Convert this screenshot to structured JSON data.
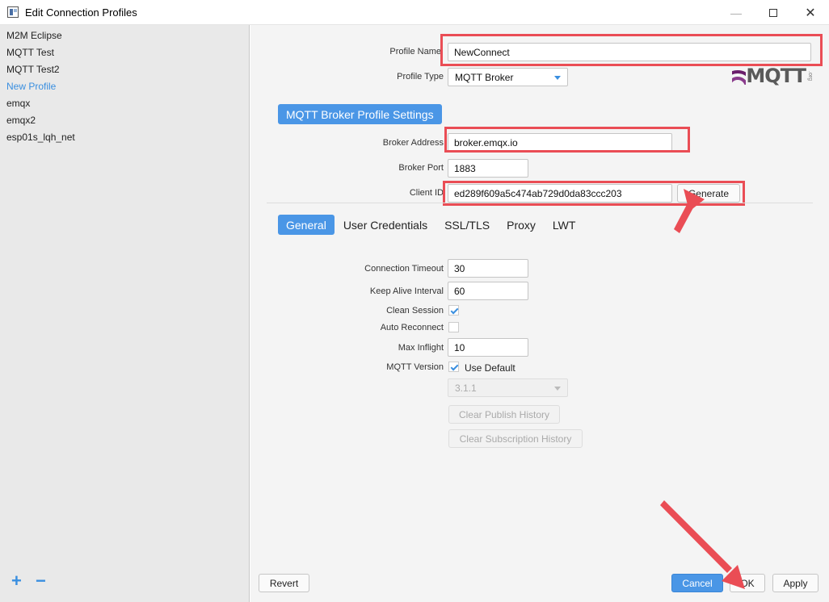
{
  "window": {
    "title": "Edit Connection Profiles",
    "min_icon": "minimize-icon",
    "max_icon": "maximize-icon",
    "close_icon": "close-icon"
  },
  "sidebar": {
    "profiles": [
      "M2M Eclipse",
      "MQTT Test",
      "MQTT Test2",
      "New Profile",
      "emqx",
      "emqx2",
      "esp01s_lqh_net"
    ],
    "selected": "New Profile",
    "add_label": "+",
    "remove_label": "−"
  },
  "profile": {
    "name_label": "Profile Name",
    "name_value": "NewConnect",
    "type_label": "Profile Type",
    "type_value": "MQTT Broker"
  },
  "logo": {
    "text": "MQTT",
    "org": ".org"
  },
  "broker": {
    "section_title": "MQTT Broker Profile Settings",
    "address_label": "Broker Address",
    "address_value": "broker.emqx.io",
    "port_label": "Broker Port",
    "port_value": "1883",
    "client_id_label": "Client ID",
    "client_id_value": "ed289f609a5c474ab729d0da83ccc203",
    "generate_label": "Generate"
  },
  "tabs": [
    "General",
    "User Credentials",
    "SSL/TLS",
    "Proxy",
    "LWT"
  ],
  "active_tab": "General",
  "general": {
    "timeout_label": "Connection Timeout",
    "timeout_value": "30",
    "keepalive_label": "Keep Alive Interval",
    "keepalive_value": "60",
    "clean_session_label": "Clean Session",
    "clean_session": true,
    "auto_reconnect_label": "Auto Reconnect",
    "auto_reconnect": false,
    "max_inflight_label": "Max Inflight",
    "max_inflight_value": "10",
    "mqtt_version_label": "MQTT Version",
    "use_default_label": "Use Default",
    "use_default": true,
    "version_value": "3.1.1",
    "clear_publish_label": "Clear Publish History",
    "clear_subscription_label": "Clear Subscription History"
  },
  "footer": {
    "revert_label": "Revert",
    "cancel_label": "Cancel",
    "ok_label": "OK",
    "apply_label": "Apply"
  },
  "colors": {
    "accent": "#4a96e6",
    "highlight": "#ea4d55"
  }
}
